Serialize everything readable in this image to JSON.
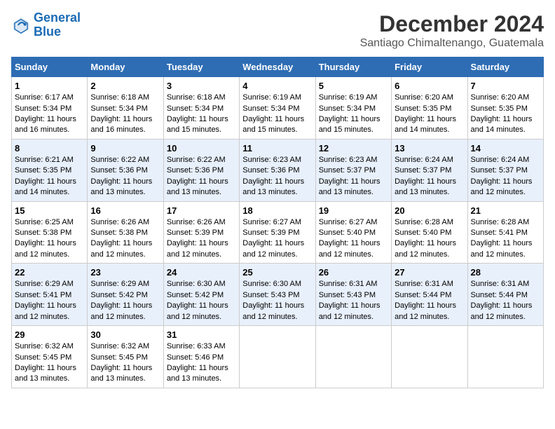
{
  "header": {
    "logo_line1": "General",
    "logo_line2": "Blue",
    "title": "December 2024",
    "subtitle": "Santiago Chimaltenango, Guatemala"
  },
  "weekdays": [
    "Sunday",
    "Monday",
    "Tuesday",
    "Wednesday",
    "Thursday",
    "Friday",
    "Saturday"
  ],
  "weeks": [
    [
      {
        "day": 1,
        "lines": [
          "Sunrise: 6:17 AM",
          "Sunset: 5:34 PM",
          "Daylight: 11 hours",
          "and 16 minutes."
        ]
      },
      {
        "day": 2,
        "lines": [
          "Sunrise: 6:18 AM",
          "Sunset: 5:34 PM",
          "Daylight: 11 hours",
          "and 16 minutes."
        ]
      },
      {
        "day": 3,
        "lines": [
          "Sunrise: 6:18 AM",
          "Sunset: 5:34 PM",
          "Daylight: 11 hours",
          "and 15 minutes."
        ]
      },
      {
        "day": 4,
        "lines": [
          "Sunrise: 6:19 AM",
          "Sunset: 5:34 PM",
          "Daylight: 11 hours",
          "and 15 minutes."
        ]
      },
      {
        "day": 5,
        "lines": [
          "Sunrise: 6:19 AM",
          "Sunset: 5:34 PM",
          "Daylight: 11 hours",
          "and 15 minutes."
        ]
      },
      {
        "day": 6,
        "lines": [
          "Sunrise: 6:20 AM",
          "Sunset: 5:35 PM",
          "Daylight: 11 hours",
          "and 14 minutes."
        ]
      },
      {
        "day": 7,
        "lines": [
          "Sunrise: 6:20 AM",
          "Sunset: 5:35 PM",
          "Daylight: 11 hours",
          "and 14 minutes."
        ]
      }
    ],
    [
      {
        "day": 8,
        "lines": [
          "Sunrise: 6:21 AM",
          "Sunset: 5:35 PM",
          "Daylight: 11 hours",
          "and 14 minutes."
        ]
      },
      {
        "day": 9,
        "lines": [
          "Sunrise: 6:22 AM",
          "Sunset: 5:36 PM",
          "Daylight: 11 hours",
          "and 13 minutes."
        ]
      },
      {
        "day": 10,
        "lines": [
          "Sunrise: 6:22 AM",
          "Sunset: 5:36 PM",
          "Daylight: 11 hours",
          "and 13 minutes."
        ]
      },
      {
        "day": 11,
        "lines": [
          "Sunrise: 6:23 AM",
          "Sunset: 5:36 PM",
          "Daylight: 11 hours",
          "and 13 minutes."
        ]
      },
      {
        "day": 12,
        "lines": [
          "Sunrise: 6:23 AM",
          "Sunset: 5:37 PM",
          "Daylight: 11 hours",
          "and 13 minutes."
        ]
      },
      {
        "day": 13,
        "lines": [
          "Sunrise: 6:24 AM",
          "Sunset: 5:37 PM",
          "Daylight: 11 hours",
          "and 13 minutes."
        ]
      },
      {
        "day": 14,
        "lines": [
          "Sunrise: 6:24 AM",
          "Sunset: 5:37 PM",
          "Daylight: 11 hours",
          "and 12 minutes."
        ]
      }
    ],
    [
      {
        "day": 15,
        "lines": [
          "Sunrise: 6:25 AM",
          "Sunset: 5:38 PM",
          "Daylight: 11 hours",
          "and 12 minutes."
        ]
      },
      {
        "day": 16,
        "lines": [
          "Sunrise: 6:26 AM",
          "Sunset: 5:38 PM",
          "Daylight: 11 hours",
          "and 12 minutes."
        ]
      },
      {
        "day": 17,
        "lines": [
          "Sunrise: 6:26 AM",
          "Sunset: 5:39 PM",
          "Daylight: 11 hours",
          "and 12 minutes."
        ]
      },
      {
        "day": 18,
        "lines": [
          "Sunrise: 6:27 AM",
          "Sunset: 5:39 PM",
          "Daylight: 11 hours",
          "and 12 minutes."
        ]
      },
      {
        "day": 19,
        "lines": [
          "Sunrise: 6:27 AM",
          "Sunset: 5:40 PM",
          "Daylight: 11 hours",
          "and 12 minutes."
        ]
      },
      {
        "day": 20,
        "lines": [
          "Sunrise: 6:28 AM",
          "Sunset: 5:40 PM",
          "Daylight: 11 hours",
          "and 12 minutes."
        ]
      },
      {
        "day": 21,
        "lines": [
          "Sunrise: 6:28 AM",
          "Sunset: 5:41 PM",
          "Daylight: 11 hours",
          "and 12 minutes."
        ]
      }
    ],
    [
      {
        "day": 22,
        "lines": [
          "Sunrise: 6:29 AM",
          "Sunset: 5:41 PM",
          "Daylight: 11 hours",
          "and 12 minutes."
        ]
      },
      {
        "day": 23,
        "lines": [
          "Sunrise: 6:29 AM",
          "Sunset: 5:42 PM",
          "Daylight: 11 hours",
          "and 12 minutes."
        ]
      },
      {
        "day": 24,
        "lines": [
          "Sunrise: 6:30 AM",
          "Sunset: 5:42 PM",
          "Daylight: 11 hours",
          "and 12 minutes."
        ]
      },
      {
        "day": 25,
        "lines": [
          "Sunrise: 6:30 AM",
          "Sunset: 5:43 PM",
          "Daylight: 11 hours",
          "and 12 minutes."
        ]
      },
      {
        "day": 26,
        "lines": [
          "Sunrise: 6:31 AM",
          "Sunset: 5:43 PM",
          "Daylight: 11 hours",
          "and 12 minutes."
        ]
      },
      {
        "day": 27,
        "lines": [
          "Sunrise: 6:31 AM",
          "Sunset: 5:44 PM",
          "Daylight: 11 hours",
          "and 12 minutes."
        ]
      },
      {
        "day": 28,
        "lines": [
          "Sunrise: 6:31 AM",
          "Sunset: 5:44 PM",
          "Daylight: 11 hours",
          "and 12 minutes."
        ]
      }
    ],
    [
      {
        "day": 29,
        "lines": [
          "Sunrise: 6:32 AM",
          "Sunset: 5:45 PM",
          "Daylight: 11 hours",
          "and 13 minutes."
        ]
      },
      {
        "day": 30,
        "lines": [
          "Sunrise: 6:32 AM",
          "Sunset: 5:45 PM",
          "Daylight: 11 hours",
          "and 13 minutes."
        ]
      },
      {
        "day": 31,
        "lines": [
          "Sunrise: 6:33 AM",
          "Sunset: 5:46 PM",
          "Daylight: 11 hours",
          "and 13 minutes."
        ]
      },
      null,
      null,
      null,
      null
    ]
  ]
}
